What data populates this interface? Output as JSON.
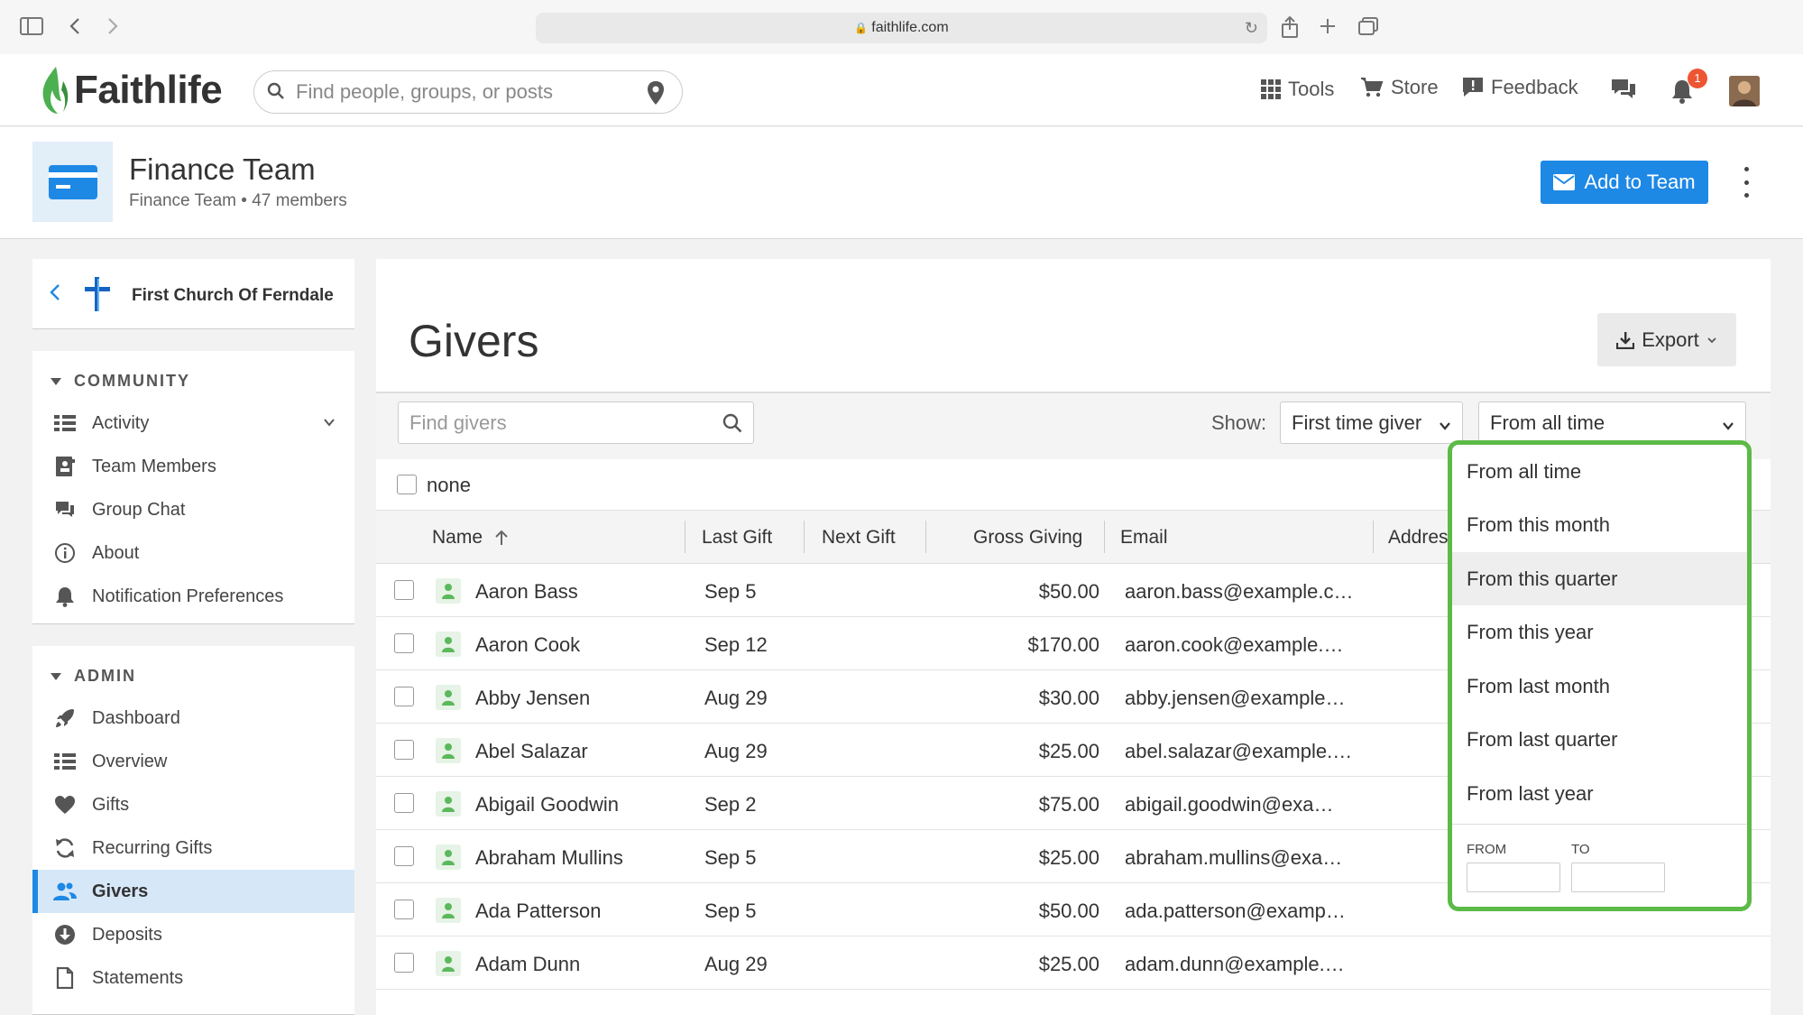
{
  "browser": {
    "url": "faithlife.com"
  },
  "site": {
    "brand": "Faithlife",
    "search_placeholder": "Find people, groups, or posts",
    "nav": {
      "tools": "Tools",
      "store": "Store",
      "feedback": "Feedback"
    },
    "notification_count": "1"
  },
  "group": {
    "title": "Finance Team",
    "subtitle": "Finance Team  •  47 members",
    "add_button": "Add to Team"
  },
  "sidebar": {
    "church": "First Church Of Ferndale",
    "community_heading": "COMMUNITY",
    "community_items": [
      {
        "label": "Activity"
      },
      {
        "label": "Team Members"
      },
      {
        "label": "Group Chat"
      },
      {
        "label": "About"
      },
      {
        "label": "Notification Preferences"
      }
    ],
    "admin_heading": "ADMIN",
    "admin_items": [
      {
        "label": "Dashboard"
      },
      {
        "label": "Overview"
      },
      {
        "label": "Gifts"
      },
      {
        "label": "Recurring Gifts"
      },
      {
        "label": "Givers"
      },
      {
        "label": "Deposits"
      },
      {
        "label": "Statements"
      }
    ]
  },
  "main": {
    "title": "Givers",
    "export_label": "Export",
    "find_placeholder": "Find givers",
    "show_label": "Show:",
    "show_value": "First time giver",
    "range_value": "From all time",
    "select_label": "none",
    "columns": {
      "name": "Name",
      "last_gift": "Last Gift",
      "next_gift": "Next Gift",
      "gross": "Gross Giving",
      "email": "Email",
      "address": "Address"
    },
    "rows": [
      {
        "name": "Aaron Bass",
        "last_gift": "Sep 5",
        "gross": "$50.00",
        "email": "aaron.bass@example.c…"
      },
      {
        "name": "Aaron Cook",
        "last_gift": "Sep 12",
        "gross": "$170.00",
        "email": "aaron.cook@example.…"
      },
      {
        "name": "Abby Jensen",
        "last_gift": "Aug 29",
        "gross": "$30.00",
        "email": "abby.jensen@example…"
      },
      {
        "name": "Abel Salazar",
        "last_gift": "Aug 29",
        "gross": "$25.00",
        "email": "abel.salazar@example.…"
      },
      {
        "name": "Abigail Goodwin",
        "last_gift": "Sep 2",
        "gross": "$75.00",
        "email": "abigail.goodwin@exa…"
      },
      {
        "name": "Abraham Mullins",
        "last_gift": "Sep 5",
        "gross": "$25.00",
        "email": "abraham.mullins@exa…"
      },
      {
        "name": "Ada Patterson",
        "last_gift": "Sep 5",
        "gross": "$50.00",
        "email": "ada.patterson@examp…"
      },
      {
        "name": "Adam Dunn",
        "last_gift": "Aug 29",
        "gross": "$25.00",
        "email": "adam.dunn@example.…"
      }
    ]
  },
  "dropdown": {
    "options": [
      {
        "label": "From all time"
      },
      {
        "label": "From this month"
      },
      {
        "label": "From this quarter"
      },
      {
        "label": "From this year"
      },
      {
        "label": "From last month"
      },
      {
        "label": "From last quarter"
      },
      {
        "label": "From last year"
      }
    ],
    "highlighted": "From this quarter",
    "from_label": "FROM",
    "to_label": "TO"
  },
  "colors": {
    "accent": "#1e88e5",
    "highlight_border": "#5cba47",
    "brand_green": "#4caf50"
  }
}
